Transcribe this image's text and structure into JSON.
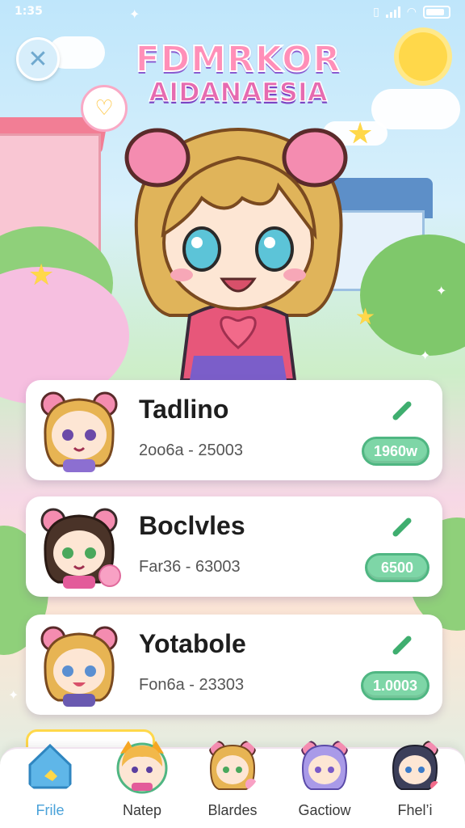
{
  "status_bar": {
    "time": "1:35"
  },
  "game": {
    "title_line1": "FDMRKOR",
    "title_line2": "AIDANAESIA"
  },
  "cards": [
    {
      "name": "Tadlino",
      "subtitle": "2oo6a - 25003",
      "badge": "1960w"
    },
    {
      "name": "Boclvles",
      "subtitle": "Far36 - 63003",
      "badge": "6500"
    },
    {
      "name": "Yotabole",
      "subtitle": "Fon6a - 23303",
      "badge": "1.0003"
    }
  ],
  "bottom_nav": [
    {
      "label": "Frile",
      "icon": "home-icon"
    },
    {
      "label": "Natep",
      "icon": "fox-avatar-icon"
    },
    {
      "label": "Blardes",
      "icon": "girl-avatar-icon"
    },
    {
      "label": "Gactiow",
      "icon": "purple-avatar-icon"
    },
    {
      "label": "Fhel’i",
      "icon": "dark-avatar-icon"
    }
  ],
  "colors": {
    "accent_green": "#7ed6a7",
    "title_pink": "#ff8fb8",
    "nav_active": "#4aa2d9"
  }
}
